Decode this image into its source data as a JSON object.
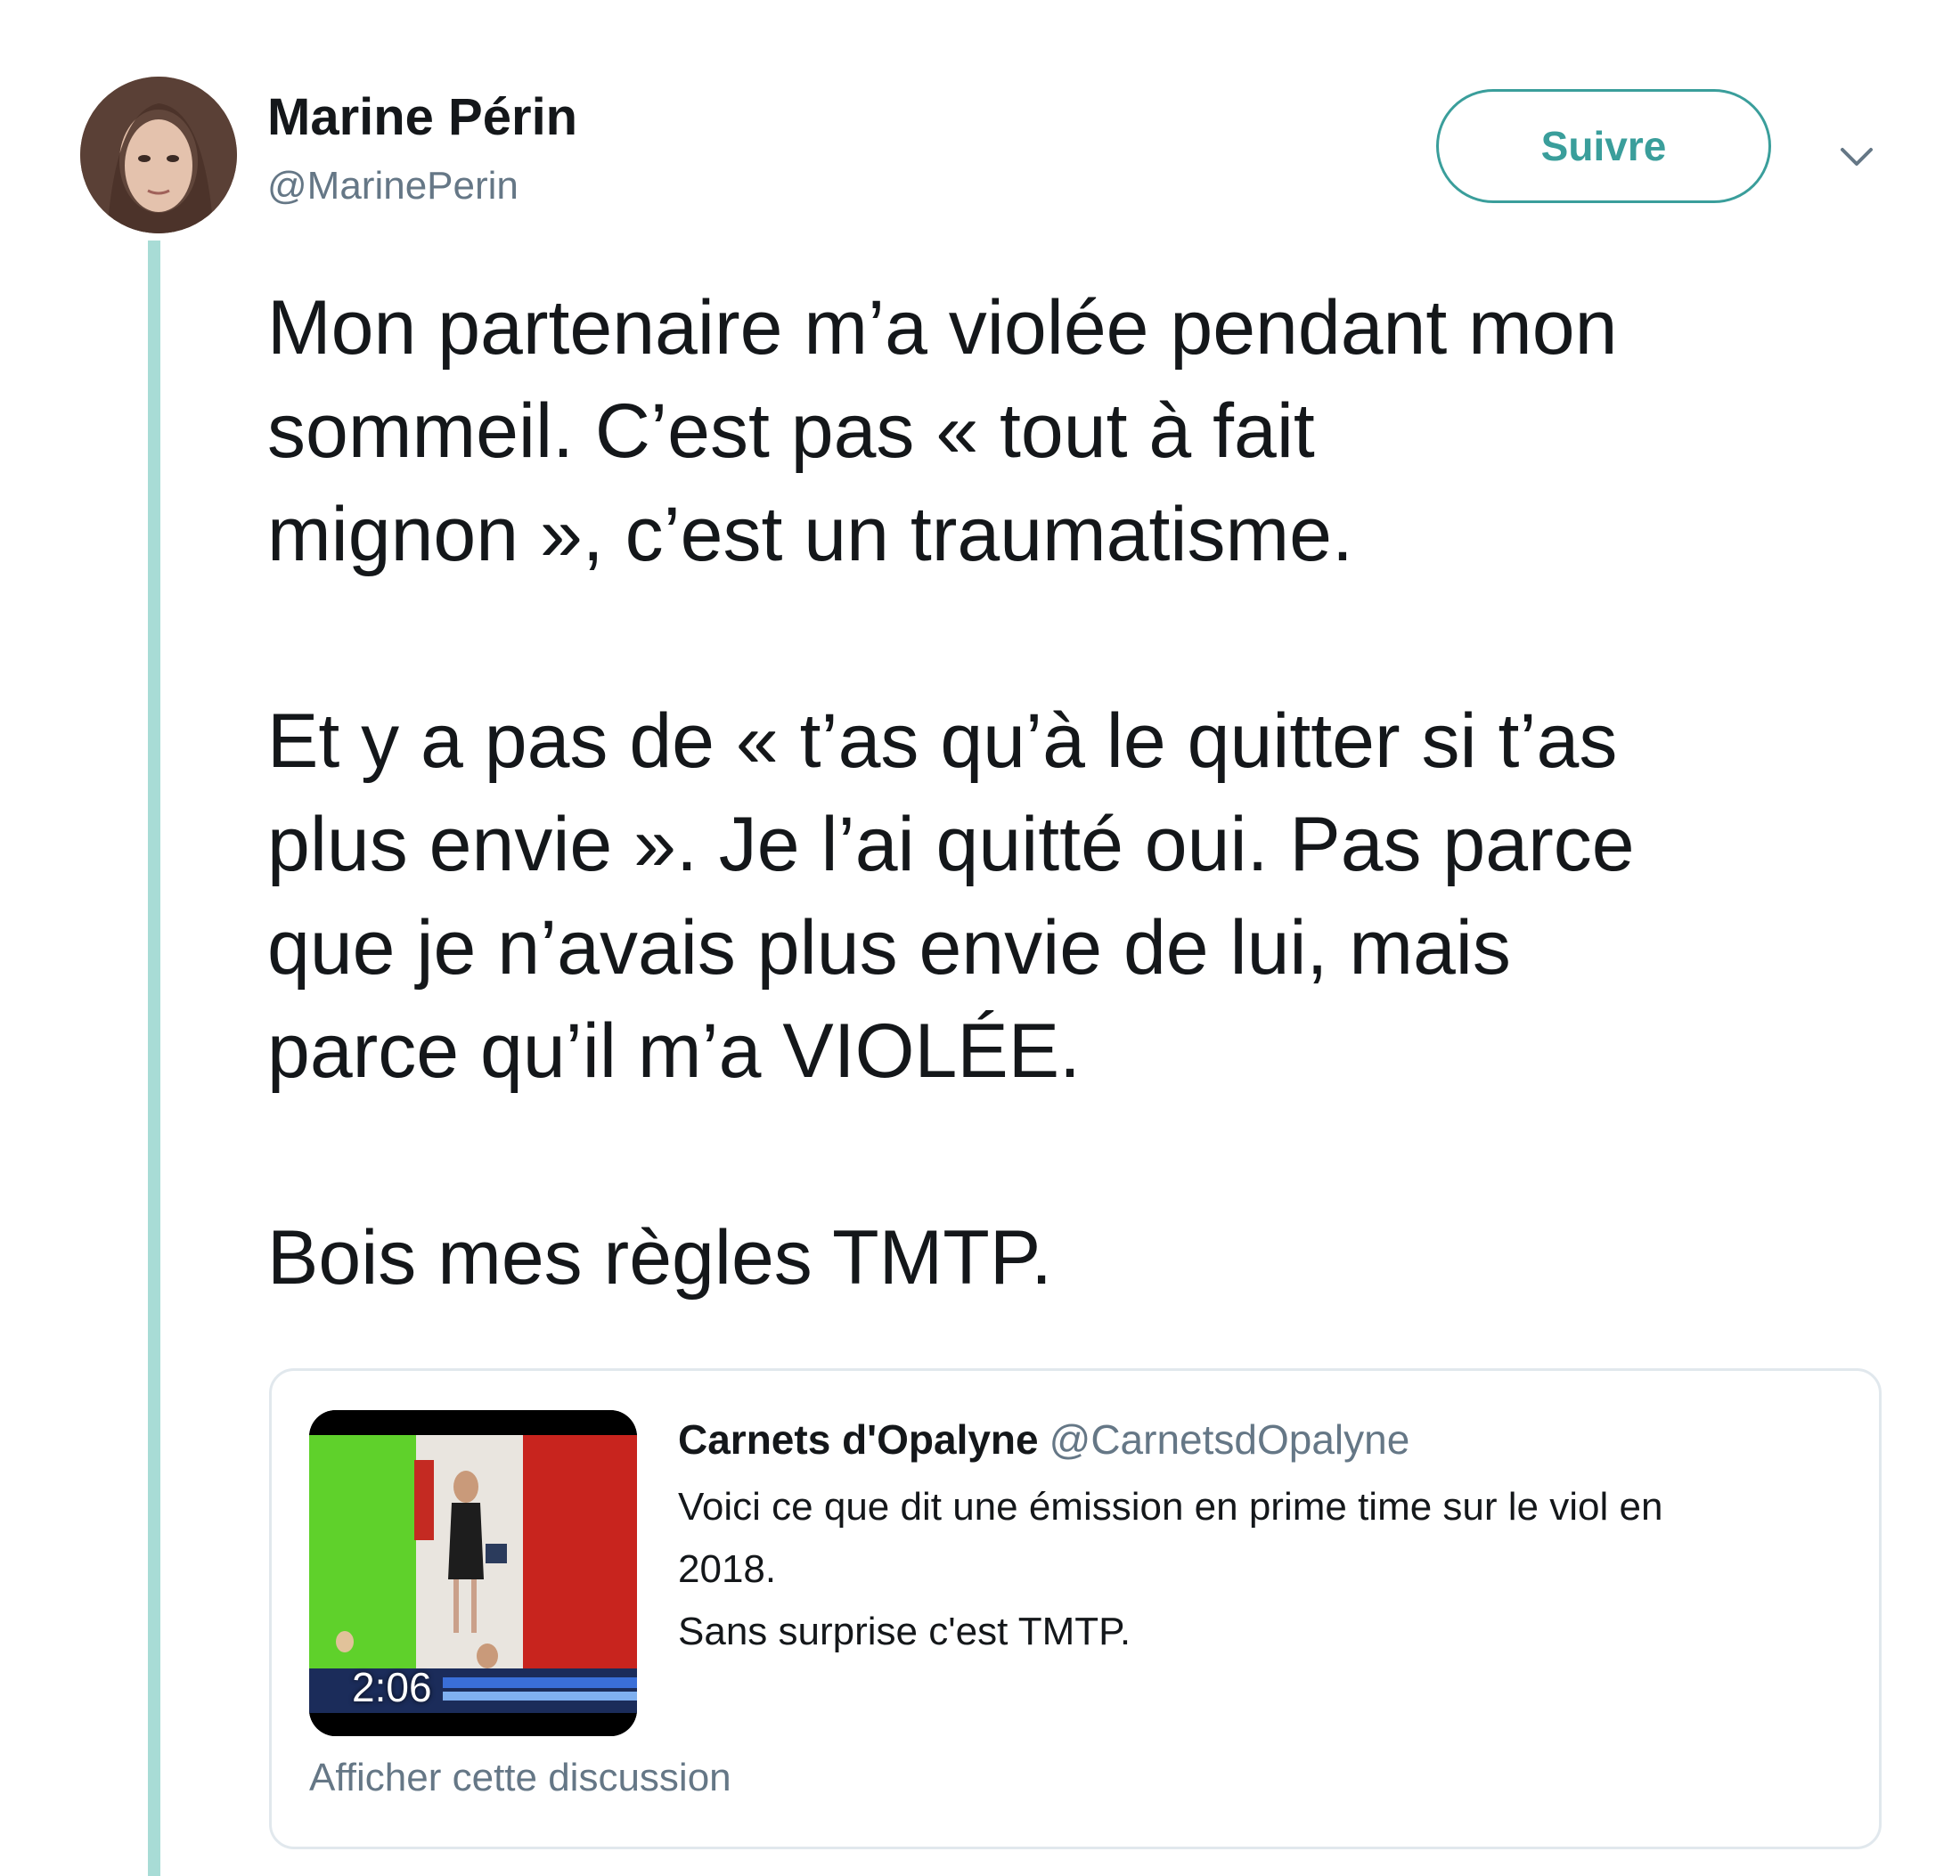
{
  "author": {
    "display_name": "Marine Périn",
    "handle": "@MarinePerin"
  },
  "follow_label": "Suivre",
  "tweet": {
    "paragraphs": [
      "Mon partenaire m’a violée pendant mon\nsommeil. C’est pas « tout à fait\nmignon », c’est un traumatisme.",
      "Et y a pas de « t’as qu’à le quitter si t’as\nplus envie ». Je l’ai quitté oui. Pas parce\nque je n’avais plus envie de lui, mais\nparce qu’il m’a VIOLÉE.",
      "Bois mes règles TMTP."
    ]
  },
  "quoted_tweet": {
    "display_name": "Carnets d'Opalyne",
    "handle": "@CarnetsdOpalyne",
    "text": "Voici ce que dit une émission en prime time sur le viol en\n2018.\nSans surprise c'est TMTP.",
    "video_duration": "2:06",
    "show_thread_label": "Afficher cette discussion"
  },
  "colors": {
    "accent": "#3a9e9b",
    "thread_line": "#a8dcd6",
    "secondary_text": "#657786",
    "card_border": "#e1e8ed"
  },
  "icons": {
    "menu": "chevron-down-icon",
    "avatar": "avatar",
    "video": "video-thumbnail"
  }
}
